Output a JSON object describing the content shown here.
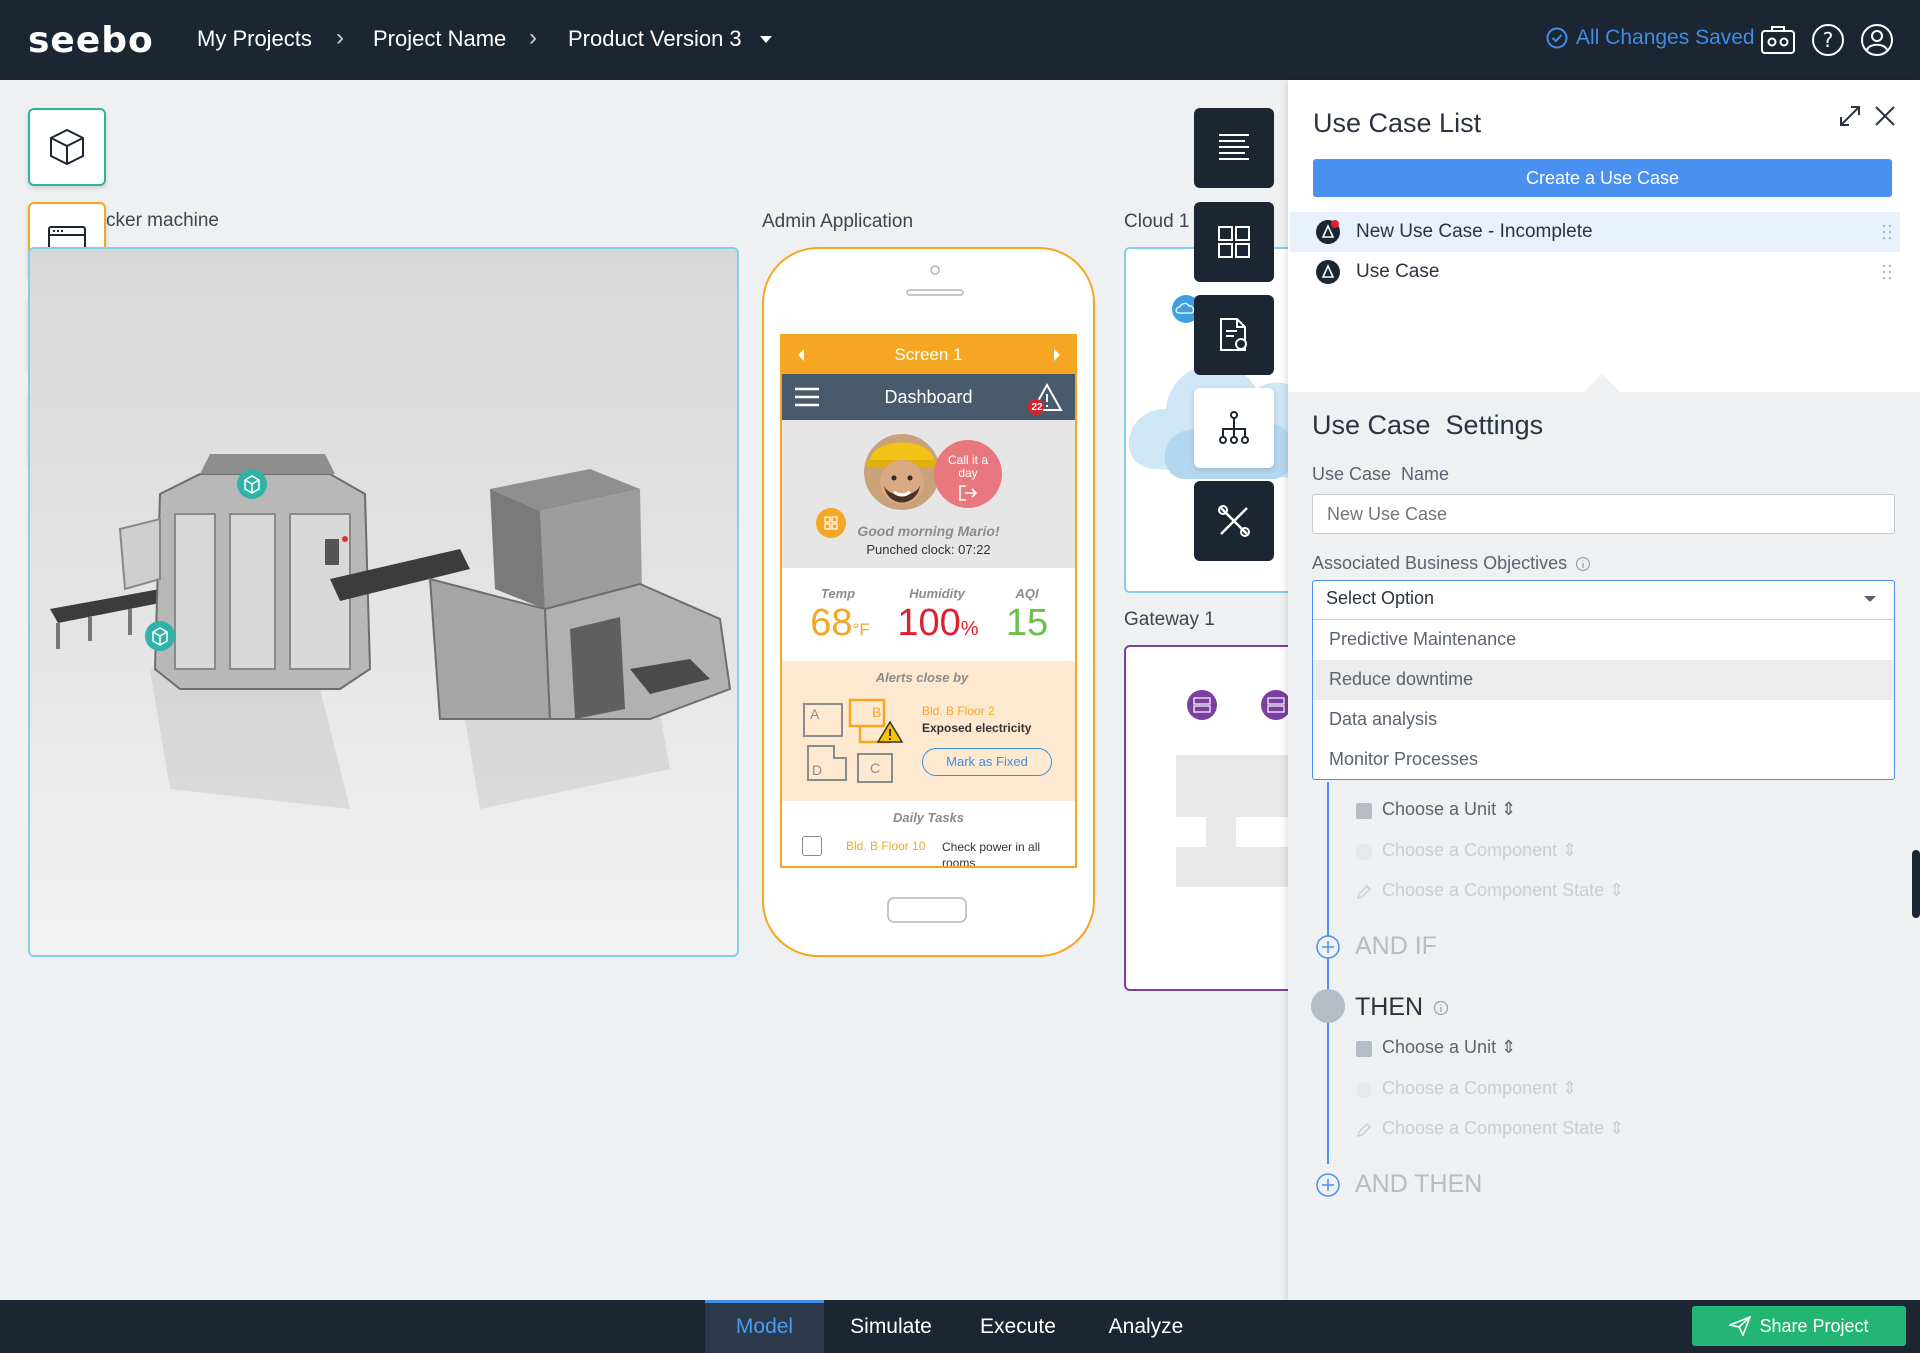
{
  "header": {
    "breadcrumbs": [
      "My Projects",
      "Project Name",
      "Product Version 3"
    ],
    "saved_status": "All Changes Saved"
  },
  "canvas": {
    "machine_label": "cker machine",
    "app_label": "Admin Application",
    "cloud_label": "Cloud 1",
    "gateway_label": "Gateway 1"
  },
  "phone": {
    "screen_title": "Screen 1",
    "app_title": "Dashboard",
    "alert_count": "22",
    "call_badge": "Call it a day",
    "greeting": "Good morning Mario!",
    "punched": "Punched clock: 07:22",
    "stats": [
      {
        "label": "Temp",
        "value": "68",
        "unit": "°F",
        "color": "#f5a623"
      },
      {
        "label": "Humidity",
        "value": "100",
        "unit": "%",
        "color": "#e0202c"
      },
      {
        "label": "AQI",
        "value": "15",
        "unit": "",
        "color": "#6cc04a"
      }
    ],
    "alerts_title": "Alerts close by",
    "alert_location": "Bld. B Floor 2",
    "alert_text": "Exposed electricity",
    "mark_fixed": "Mark as Fixed",
    "map_labels": [
      "A",
      "B",
      "C",
      "D"
    ],
    "tasks_title": "Daily Tasks",
    "task_location": "Bld. B Floor 10",
    "task_text": "Check power in all rooms"
  },
  "panel": {
    "title": "Use Case List",
    "create_button": "Create a Use Case",
    "use_cases": [
      {
        "label": "New Use Case - Incomplete"
      },
      {
        "label": "Use Case"
      }
    ],
    "settings_title": "Use Case  Settings",
    "name_label": "Use Case  Name",
    "name_placeholder": "New Use Case",
    "objectives_label": "Associated Business Objectives",
    "select_value": "Select Option",
    "options": [
      "Predictive Maintenance",
      "Reduce downtime",
      "Data analysis",
      "Monitor Processes"
    ],
    "choose_unit": "Choose a Unit",
    "choose_component": "Choose a Component",
    "choose_state": "Choose a Component State",
    "and_if": "AND IF",
    "then": "THEN",
    "and_then": "AND THEN"
  },
  "bottom": {
    "tabs": [
      "Model",
      "Simulate",
      "Execute",
      "Analyze"
    ],
    "share": "Share Project"
  },
  "colors": {
    "topbar": "#1c2532",
    "accent_blue": "#3f8de6",
    "orange": "#f5a623",
    "teal": "#2fb3a6",
    "purple": "#7b3fa0",
    "green": "#22b573"
  }
}
